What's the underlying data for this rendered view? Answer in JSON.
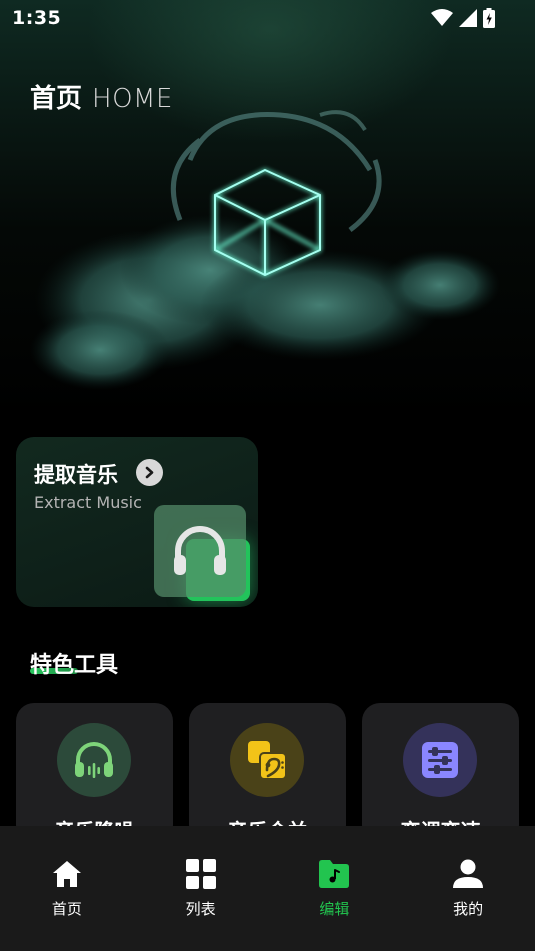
{
  "status_bar": {
    "time": "1:35"
  },
  "header": {
    "title_cn": "首页",
    "title_en": "HOME"
  },
  "extract_card": {
    "title": "提取音乐",
    "subtitle": "Extract Music",
    "icon": "headphones-icon"
  },
  "features": {
    "title": "特色工具",
    "tools": [
      {
        "label": "音乐降噪",
        "icon": "headphones-wave-icon",
        "color": "#7ed47a"
      },
      {
        "label": "音乐合并",
        "icon": "bass-clef-icon",
        "color": "#f2c318"
      },
      {
        "label": "变调变速",
        "icon": "sliders-icon",
        "color": "#8a86ff"
      }
    ]
  },
  "bottom_nav": {
    "items": [
      {
        "label": "首页",
        "icon": "home-icon"
      },
      {
        "label": "列表",
        "icon": "grid-icon"
      },
      {
        "label": "编辑",
        "icon": "folder-music-icon",
        "active": true
      },
      {
        "label": "我的",
        "icon": "user-icon"
      }
    ]
  },
  "colors": {
    "accent": "#22c44f",
    "card": "#1f1f21",
    "nav": "#1a1a1a"
  }
}
